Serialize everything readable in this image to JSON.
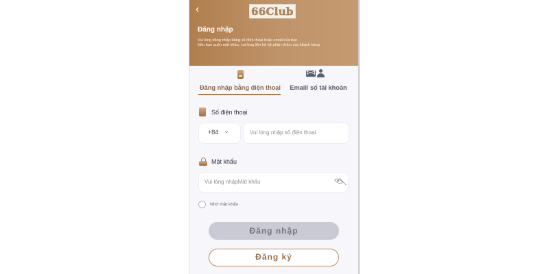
{
  "header": {
    "logo_text": "66Club",
    "back_symbol": "‹",
    "title": "Đăng nhập",
    "description": "Vui lòng đăng nhập bằng số điện thoại hoặc email của bạn\nNếu bạn quên mật khẩu, vui lòng liên hệ bộ phận chăm sóc khách hàng"
  },
  "tabs": [
    {
      "label": "Đăng nhập bằng điện thoại",
      "icon": "phone-icon",
      "active": true
    },
    {
      "label": "Email/ số tài khoản",
      "icon": "mail-user-icon",
      "active": false
    }
  ],
  "form": {
    "phone_label": "Số điện thoại",
    "country_code": "+84",
    "phone_placeholder": "Vui lòng nhập số điện thoại",
    "password_label": "Mật khẩu",
    "password_placeholder": "Vui lòng nhậpMật khẩu",
    "remember_label": "Nhớ mật khẩu"
  },
  "buttons": {
    "login": "Đăng nhập",
    "register": "Đăng ký"
  },
  "colors": {
    "accent": "#b07e4e",
    "login_button_bg": "#c9cad3",
    "register_border": "#b88c62"
  }
}
